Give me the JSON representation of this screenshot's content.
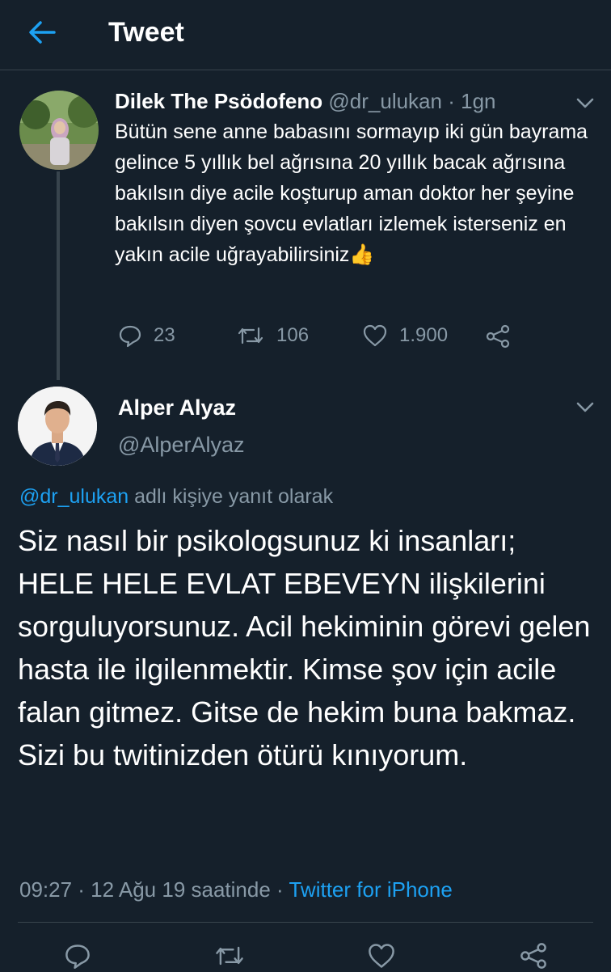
{
  "header": {
    "title": "Tweet",
    "back_icon": "arrow-left-icon"
  },
  "colors": {
    "background": "#15202b",
    "accent": "#1da1f2",
    "muted": "#8899a6",
    "border": "#38444d"
  },
  "parent_tweet": {
    "name": "Dilek The Psödofeno",
    "handle": "@dr_ulukan",
    "separator": "·",
    "time": "1gn",
    "text": "Bütün sene anne babasını sormayıp iki gün bayrama gelince 5 yıllık bel ağrısına 20 yıllık bacak ağrısına bakılsın diye acile koşturup aman doktor her şeyine bakılsın diyen şovcu evlatları izlemek isterseniz en yakın acile uğrayabilirsiniz👍",
    "actions": {
      "replies": "23",
      "retweets": "106",
      "likes": "1.900"
    }
  },
  "main_tweet": {
    "name": "Alper Alyaz",
    "handle": "@AlperAlyaz",
    "replying_handle": "@dr_ulukan",
    "replying_suffix": "adlı kişiye yanıt olarak",
    "text": "Siz nasıl bir psikologsunuz ki insanları; HELE HELE EVLAT EBEVEYN ilişkilerini sorguluyorsunuz. Acil hekiminin görevi gelen hasta ile ilgilenmektir. Kimse şov için acile falan gitmez. Gitse de hekim buna bakmaz. Sizi bu twitinizden ötürü kınıyorum.",
    "timestamp": "09:27 · 12 Ağu 19 saatinde",
    "meta_separator": "·",
    "source": "Twitter for iPhone"
  }
}
